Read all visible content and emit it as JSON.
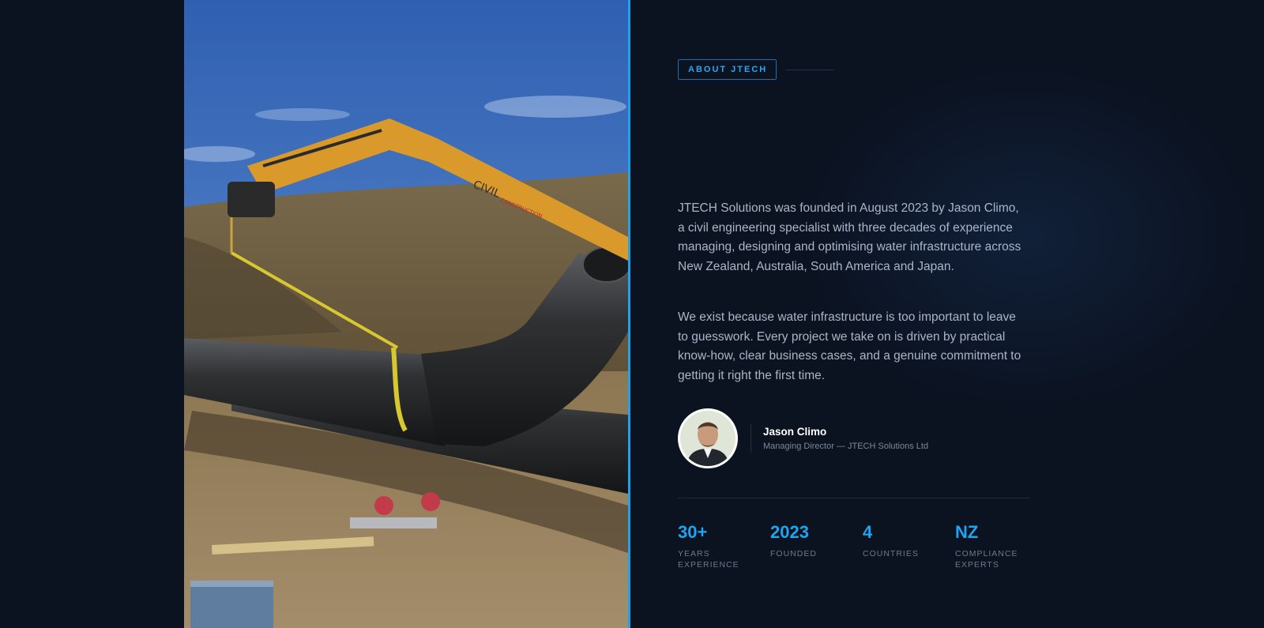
{
  "about": {
    "eyebrow": "ABOUT JTECH",
    "paragraphs": [
      "JTECH Solutions was founded in August 2023 by Jason Climo, a civil engineering specialist with three decades of experience managing, designing and optimising water infrastructure across New Zealand, Australia, South America and Japan.",
      "We exist because water infrastructure is too important to leave to guesswork. Every project we take on is driven by practical know-how, clear business cases, and a genuine commitment to getting it right the first time."
    ]
  },
  "photo": {
    "machine_label_1": "CIVIL",
    "machine_label_2": "CONSTRUCTION"
  },
  "founder": {
    "name": "Jason Climo",
    "role": "Managing Director — JTECH Solutions Ltd"
  },
  "stats": [
    {
      "value": "30+",
      "label": "YEARS EXPERIENCE"
    },
    {
      "value": "2023",
      "label": "FOUNDED"
    },
    {
      "value": "4",
      "label": "COUNTRIES"
    },
    {
      "value": "NZ",
      "label": "COMPLIANCE EXPERTS"
    }
  ],
  "colors": {
    "background": "#0b1220",
    "accent": "#1ea5f0",
    "body_text": "#a9b6c8",
    "muted_text": "#6c7a8e"
  }
}
